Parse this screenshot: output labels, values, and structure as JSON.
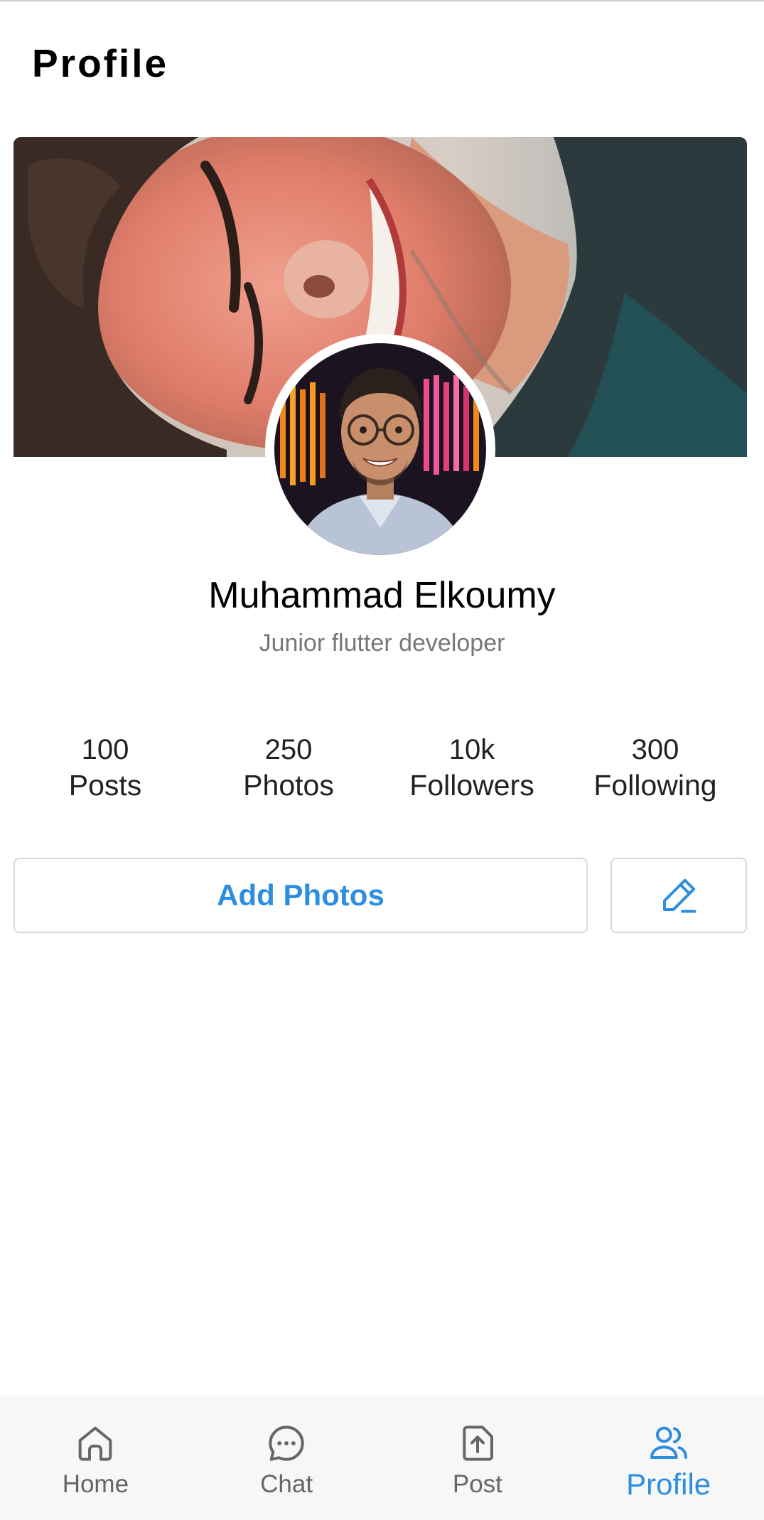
{
  "header": {
    "title": "Profile"
  },
  "profile": {
    "cover_image": "cover-photo",
    "avatar_image": "profile-photo",
    "name": "Muhammad Elkoumy",
    "bio": "Junior flutter developer"
  },
  "stats": [
    {
      "value": "100",
      "label": "Posts"
    },
    {
      "value": "250",
      "label": "Photos"
    },
    {
      "value": "10k",
      "label": "Followers"
    },
    {
      "value": "300",
      "label": "Following"
    }
  ],
  "actions": {
    "add_photos_label": "Add Photos",
    "edit_icon": "pencil-icon"
  },
  "bottom_nav": {
    "items": [
      {
        "label": "Home",
        "icon": "home-icon",
        "active": false
      },
      {
        "label": "Chat",
        "icon": "chat-icon",
        "active": false
      },
      {
        "label": "Post",
        "icon": "upload-icon",
        "active": false
      },
      {
        "label": "Profile",
        "icon": "people-icon",
        "active": true
      }
    ]
  },
  "colors": {
    "accent": "#2d8ee0",
    "inactive": "#666666",
    "nav_background": "#f7f7f7",
    "border": "#d9d9d9"
  }
}
